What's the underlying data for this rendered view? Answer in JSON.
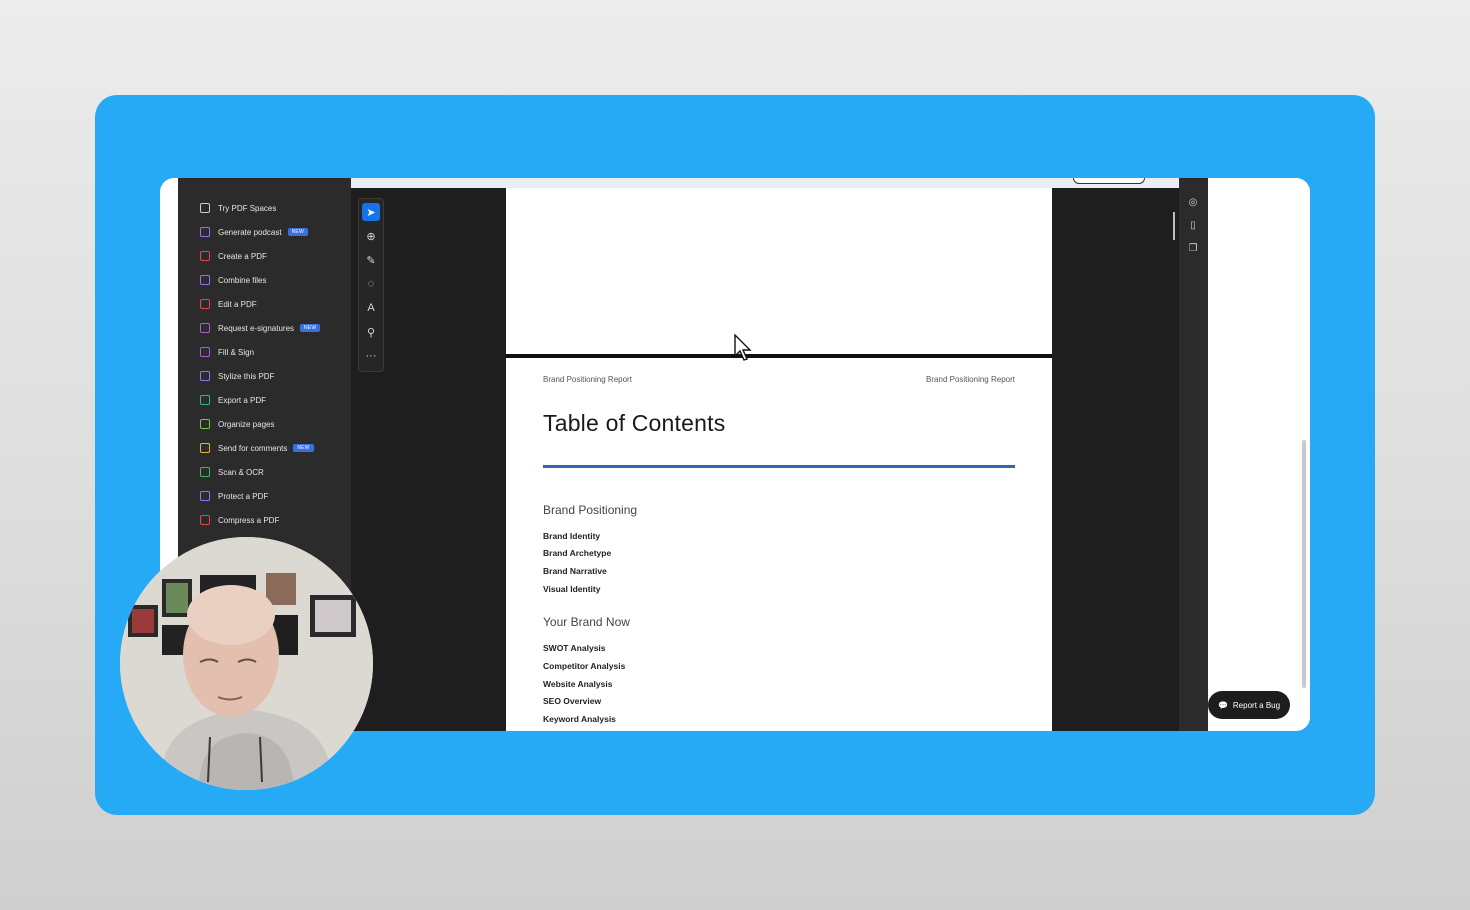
{
  "sidebar": {
    "items": [
      {
        "label": "Try PDF Spaces",
        "icon": "spaces-icon",
        "color": "#c9c9c9",
        "badge": ""
      },
      {
        "label": "Generate podcast",
        "icon": "podcast-icon",
        "color": "#9b6cf0",
        "badge": "NEW"
      },
      {
        "label": "Create a PDF",
        "icon": "create-pdf-icon",
        "color": "#e5484d",
        "badge": ""
      },
      {
        "label": "Combine files",
        "icon": "combine-icon",
        "color": "#9b6cf0",
        "badge": ""
      },
      {
        "label": "Edit a PDF",
        "icon": "edit-pdf-icon",
        "color": "#e5484d",
        "badge": ""
      },
      {
        "label": "Request e-signatures",
        "icon": "esign-icon",
        "color": "#b05ad8",
        "badge": "NEW"
      },
      {
        "label": "Fill & Sign",
        "icon": "fill-sign-icon",
        "color": "#b05ad8",
        "badge": ""
      },
      {
        "label": "Stylize this PDF",
        "icon": "stylize-icon",
        "color": "#7b7bf0",
        "badge": ""
      },
      {
        "label": "Export a PDF",
        "icon": "export-icon",
        "color": "#2bb3a0",
        "badge": ""
      },
      {
        "label": "Organize pages",
        "icon": "organize-icon",
        "color": "#7fc93d",
        "badge": ""
      },
      {
        "label": "Send for comments",
        "icon": "comments-icon",
        "color": "#e8b53a",
        "badge": "NEW"
      },
      {
        "label": "Scan & OCR",
        "icon": "scan-icon",
        "color": "#3fb86a",
        "badge": ""
      },
      {
        "label": "Protect a PDF",
        "icon": "protect-icon",
        "color": "#7b7bf0",
        "badge": ""
      },
      {
        "label": "Compress a PDF",
        "icon": "compress-icon",
        "color": "#e5484d",
        "badge": ""
      }
    ]
  },
  "toolbar": {
    "tools": [
      {
        "icon": "select-cursor-icon",
        "glyph": "➤",
        "active": true
      },
      {
        "icon": "zoom-icon",
        "glyph": "⊕",
        "active": false
      },
      {
        "icon": "pen-icon",
        "glyph": "✎",
        "active": false
      },
      {
        "icon": "lasso-icon",
        "glyph": "◌",
        "active": false
      },
      {
        "icon": "text-box-icon",
        "glyph": "A",
        "active": false
      },
      {
        "icon": "stamp-icon",
        "glyph": "⚲",
        "active": false
      },
      {
        "icon": "more-icon",
        "glyph": "···",
        "active": false
      }
    ]
  },
  "document": {
    "header_left": "Brand Positioning Report",
    "header_right": "Brand Positioning Report",
    "title": "Table of Contents",
    "sections": [
      {
        "heading": "Brand Positioning",
        "entries": [
          "Brand Identity",
          "Brand Archetype",
          "Brand Narrative",
          "Visual Identity"
        ]
      },
      {
        "heading": "Your Brand Now",
        "entries": [
          "SWOT Analysis",
          "Competitor Analysis",
          "Website Analysis",
          "SEO Overview",
          "Keyword Analysis"
        ]
      }
    ],
    "accent_color": "#2f66b3"
  },
  "right_rail": {
    "icons": [
      "ai-assistant-icon",
      "bookmark-comment-icon",
      "pages-icon"
    ]
  },
  "report_bug": {
    "label": "Report a Bug"
  },
  "colors": {
    "background_card": "#27aaf5",
    "sidebar": "#2b2b2b",
    "active_tool": "#1473e6"
  }
}
